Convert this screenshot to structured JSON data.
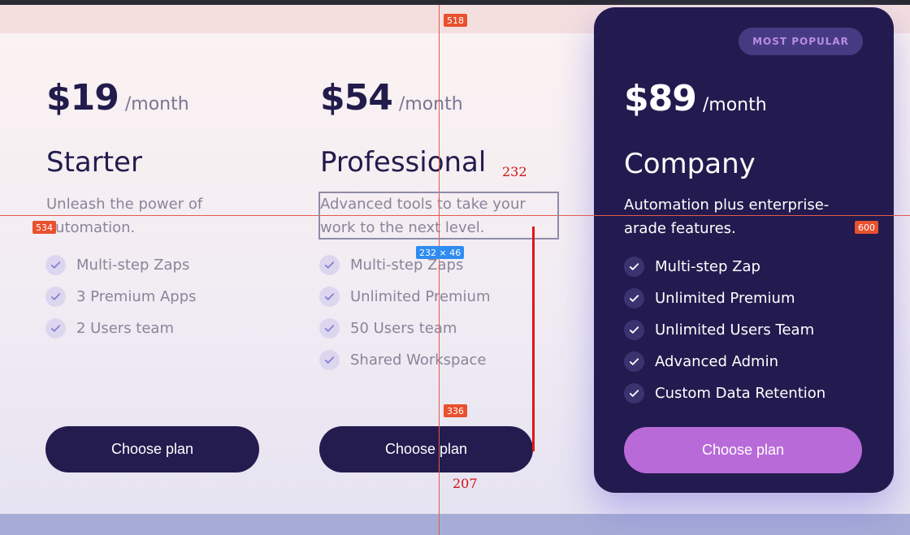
{
  "plans": [
    {
      "price": "$19",
      "period": "/month",
      "name": "Starter",
      "description": "Unleash the power of automation.",
      "features": [
        "Multi-step Zaps",
        "3 Premium Apps",
        "2 Users team"
      ],
      "button": "Choose plan"
    },
    {
      "price": "$54",
      "period": "/month",
      "name": "Professional",
      "description": "Advanced tools to take your work to the next level.",
      "features": [
        "Multi-step Zaps",
        "Unlimited Premium",
        "50 Users team",
        "Shared Workspace"
      ],
      "button": "Choose plan"
    },
    {
      "badge": "MOST POPULAR",
      "price": "$89",
      "period": "/month",
      "name": "Company",
      "description": "Automation plus enterprise-arade features.",
      "features": [
        "Multi-step Zap",
        "Unlimited Premium",
        "Unlimited Users Team",
        "Advanced Admin",
        "Custom Data Retention"
      ],
      "button": "Choose plan"
    }
  ],
  "measurements": {
    "guide_x": "518",
    "guide_y_left": "534",
    "guide_y_right": "600",
    "selection_size": "232 × 46",
    "selection_width": "232",
    "gap_to_button": "336",
    "line_length": "207"
  },
  "colors": {
    "primary": "#221c4d",
    "accent": "#b86ad8",
    "featured_card": "#231b4f"
  }
}
